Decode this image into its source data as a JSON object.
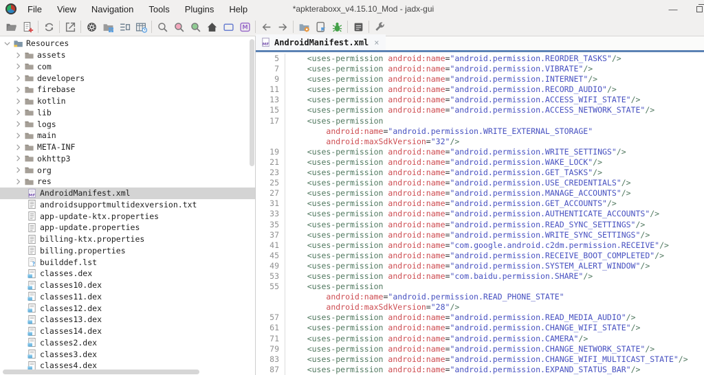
{
  "window": {
    "title": "*apkteraboxx_v4.15.10_Mod - jadx-gui",
    "controls": [
      "minimize",
      "maximize"
    ]
  },
  "colors": {
    "tab_underline": "#5B82B4",
    "selection_bg": "#D4D4D4",
    "tag": "#50785F",
    "attr": "#CD4B50",
    "value": "#4650C0",
    "line_number": "#8F8F8F"
  },
  "menu": [
    "File",
    "View",
    "Navigation",
    "Tools",
    "Plugins",
    "Help"
  ],
  "toolbar": [
    {
      "name": "open-file"
    },
    {
      "name": "add-files"
    },
    {
      "sep": true
    },
    {
      "name": "reload"
    },
    {
      "sep": true
    },
    {
      "name": "export"
    },
    {
      "sep": true
    },
    {
      "name": "deobfuscation"
    },
    {
      "name": "flat-packages"
    },
    {
      "name": "structure"
    },
    {
      "name": "heap-usage"
    },
    {
      "sep": true
    },
    {
      "name": "search"
    },
    {
      "name": "text-search"
    },
    {
      "name": "class-search"
    },
    {
      "name": "main-activity"
    },
    {
      "name": "comment"
    },
    {
      "name": "comment-search"
    },
    {
      "sep": true
    },
    {
      "name": "back"
    },
    {
      "name": "forward"
    },
    {
      "sep": true
    },
    {
      "name": "device-settings"
    },
    {
      "name": "adb-device"
    },
    {
      "name": "debugger"
    },
    {
      "sep": true
    },
    {
      "name": "log-viewer"
    },
    {
      "sep": true
    },
    {
      "name": "preferences"
    }
  ],
  "tree": {
    "items": [
      {
        "label": "Resources",
        "type": "root",
        "chev": "open"
      },
      {
        "label": "assets",
        "type": "folder",
        "chev": "closed"
      },
      {
        "label": "com",
        "type": "folder",
        "chev": "closed"
      },
      {
        "label": "developers",
        "type": "folder",
        "chev": "closed"
      },
      {
        "label": "firebase",
        "type": "folder",
        "chev": "closed"
      },
      {
        "label": "kotlin",
        "type": "folder",
        "chev": "closed"
      },
      {
        "label": "lib",
        "type": "folder",
        "chev": "closed"
      },
      {
        "label": "logs",
        "type": "folder",
        "chev": "closed"
      },
      {
        "label": "main",
        "type": "folder",
        "chev": "closed"
      },
      {
        "label": "META-INF",
        "type": "folder",
        "chev": "closed"
      },
      {
        "label": "okhttp3",
        "type": "folder",
        "chev": "closed"
      },
      {
        "label": "org",
        "type": "folder",
        "chev": "closed"
      },
      {
        "label": "res",
        "type": "folder",
        "chev": "closed"
      },
      {
        "label": "AndroidManifest.xml",
        "type": "manifest",
        "selected": true
      },
      {
        "label": "androidsupportmultidexversion.txt",
        "type": "text"
      },
      {
        "label": "app-update-ktx.properties",
        "type": "text"
      },
      {
        "label": "app-update.properties",
        "type": "text"
      },
      {
        "label": "billing-ktx.properties",
        "type": "text"
      },
      {
        "label": "billing.properties",
        "type": "text"
      },
      {
        "label": "builddef.lst",
        "type": "lst"
      },
      {
        "label": "classes.dex",
        "type": "dex"
      },
      {
        "label": "classes10.dex",
        "type": "dex"
      },
      {
        "label": "classes11.dex",
        "type": "dex"
      },
      {
        "label": "classes12.dex",
        "type": "dex"
      },
      {
        "label": "classes13.dex",
        "type": "dex"
      },
      {
        "label": "classes14.dex",
        "type": "dex"
      },
      {
        "label": "classes2.dex",
        "type": "dex"
      },
      {
        "label": "classes3.dex",
        "type": "dex"
      },
      {
        "label": "classes4.dex",
        "type": "dex"
      }
    ]
  },
  "editor": {
    "tab": "AndroidManifest.xml",
    "tab_close": "×",
    "lines": [
      {
        "num": "5",
        "segs": [
          [
            "s",
            "    "
          ],
          [
            "t",
            "<uses-permission"
          ],
          [
            "s",
            " "
          ],
          [
            "a",
            "android:name"
          ],
          [
            "e",
            "="
          ],
          [
            "v",
            "\"android.permission.REORDER_TASKS\""
          ],
          [
            "t",
            "/>"
          ]
        ]
      },
      {
        "num": "7",
        "segs": [
          [
            "s",
            "    "
          ],
          [
            "t",
            "<uses-permission"
          ],
          [
            "s",
            " "
          ],
          [
            "a",
            "android:name"
          ],
          [
            "e",
            "="
          ],
          [
            "v",
            "\"android.permission.VIBRATE\""
          ],
          [
            "t",
            "/>"
          ]
        ]
      },
      {
        "num": "9",
        "segs": [
          [
            "s",
            "    "
          ],
          [
            "t",
            "<uses-permission"
          ],
          [
            "s",
            " "
          ],
          [
            "a",
            "android:name"
          ],
          [
            "e",
            "="
          ],
          [
            "v",
            "\"android.permission.INTERNET\""
          ],
          [
            "t",
            "/>"
          ]
        ]
      },
      {
        "num": "11",
        "segs": [
          [
            "s",
            "    "
          ],
          [
            "t",
            "<uses-permission"
          ],
          [
            "s",
            " "
          ],
          [
            "a",
            "android:name"
          ],
          [
            "e",
            "="
          ],
          [
            "v",
            "\"android.permission.RECORD_AUDIO\""
          ],
          [
            "t",
            "/>"
          ]
        ]
      },
      {
        "num": "13",
        "segs": [
          [
            "s",
            "    "
          ],
          [
            "t",
            "<uses-permission"
          ],
          [
            "s",
            " "
          ],
          [
            "a",
            "android:name"
          ],
          [
            "e",
            "="
          ],
          [
            "v",
            "\"android.permission.ACCESS_WIFI_STATE\""
          ],
          [
            "t",
            "/>"
          ]
        ]
      },
      {
        "num": "15",
        "segs": [
          [
            "s",
            "    "
          ],
          [
            "t",
            "<uses-permission"
          ],
          [
            "s",
            " "
          ],
          [
            "a",
            "android:name"
          ],
          [
            "e",
            "="
          ],
          [
            "v",
            "\"android.permission.ACCESS_NETWORK_STATE\""
          ],
          [
            "t",
            "/>"
          ]
        ]
      },
      {
        "num": "17",
        "segs": [
          [
            "s",
            "    "
          ],
          [
            "t",
            "<uses-permission"
          ]
        ]
      },
      {
        "num": "",
        "segs": [
          [
            "s",
            "        "
          ],
          [
            "a",
            "android:name"
          ],
          [
            "e",
            "="
          ],
          [
            "v",
            "\"android.permission.WRITE_EXTERNAL_STORAGE\""
          ]
        ]
      },
      {
        "num": "",
        "segs": [
          [
            "s",
            "        "
          ],
          [
            "a",
            "android:maxSdkVersion"
          ],
          [
            "e",
            "="
          ],
          [
            "v",
            "\"32\""
          ],
          [
            "t",
            "/>"
          ]
        ]
      },
      {
        "num": "19",
        "segs": [
          [
            "s",
            "    "
          ],
          [
            "t",
            "<uses-permission"
          ],
          [
            "s",
            " "
          ],
          [
            "a",
            "android:name"
          ],
          [
            "e",
            "="
          ],
          [
            "v",
            "\"android.permission.WRITE_SETTINGS\""
          ],
          [
            "t",
            "/>"
          ]
        ]
      },
      {
        "num": "21",
        "segs": [
          [
            "s",
            "    "
          ],
          [
            "t",
            "<uses-permission"
          ],
          [
            "s",
            " "
          ],
          [
            "a",
            "android:name"
          ],
          [
            "e",
            "="
          ],
          [
            "v",
            "\"android.permission.WAKE_LOCK\""
          ],
          [
            "t",
            "/>"
          ]
        ]
      },
      {
        "num": "23",
        "segs": [
          [
            "s",
            "    "
          ],
          [
            "t",
            "<uses-permission"
          ],
          [
            "s",
            " "
          ],
          [
            "a",
            "android:name"
          ],
          [
            "e",
            "="
          ],
          [
            "v",
            "\"android.permission.GET_TASKS\""
          ],
          [
            "t",
            "/>"
          ]
        ]
      },
      {
        "num": "25",
        "segs": [
          [
            "s",
            "    "
          ],
          [
            "t",
            "<uses-permission"
          ],
          [
            "s",
            " "
          ],
          [
            "a",
            "android:name"
          ],
          [
            "e",
            "="
          ],
          [
            "v",
            "\"android.permission.USE_CREDENTIALS\""
          ],
          [
            "t",
            "/>"
          ]
        ]
      },
      {
        "num": "27",
        "segs": [
          [
            "s",
            "    "
          ],
          [
            "t",
            "<uses-permission"
          ],
          [
            "s",
            " "
          ],
          [
            "a",
            "android:name"
          ],
          [
            "e",
            "="
          ],
          [
            "v",
            "\"android.permission.MANAGE_ACCOUNTS\""
          ],
          [
            "t",
            "/>"
          ]
        ]
      },
      {
        "num": "31",
        "segs": [
          [
            "s",
            "    "
          ],
          [
            "t",
            "<uses-permission"
          ],
          [
            "s",
            " "
          ],
          [
            "a",
            "android:name"
          ],
          [
            "e",
            "="
          ],
          [
            "v",
            "\"android.permission.GET_ACCOUNTS\""
          ],
          [
            "t",
            "/>"
          ]
        ]
      },
      {
        "num": "33",
        "segs": [
          [
            "s",
            "    "
          ],
          [
            "t",
            "<uses-permission"
          ],
          [
            "s",
            " "
          ],
          [
            "a",
            "android:name"
          ],
          [
            "e",
            "="
          ],
          [
            "v",
            "\"android.permission.AUTHENTICATE_ACCOUNTS\""
          ],
          [
            "t",
            "/>"
          ]
        ]
      },
      {
        "num": "35",
        "segs": [
          [
            "s",
            "    "
          ],
          [
            "t",
            "<uses-permission"
          ],
          [
            "s",
            " "
          ],
          [
            "a",
            "android:name"
          ],
          [
            "e",
            "="
          ],
          [
            "v",
            "\"android.permission.READ_SYNC_SETTINGS\""
          ],
          [
            "t",
            "/>"
          ]
        ]
      },
      {
        "num": "37",
        "segs": [
          [
            "s",
            "    "
          ],
          [
            "t",
            "<uses-permission"
          ],
          [
            "s",
            " "
          ],
          [
            "a",
            "android:name"
          ],
          [
            "e",
            "="
          ],
          [
            "v",
            "\"android.permission.WRITE_SYNC_SETTINGS\""
          ],
          [
            "t",
            "/>"
          ]
        ]
      },
      {
        "num": "41",
        "segs": [
          [
            "s",
            "    "
          ],
          [
            "t",
            "<uses-permission"
          ],
          [
            "s",
            " "
          ],
          [
            "a",
            "android:name"
          ],
          [
            "e",
            "="
          ],
          [
            "v",
            "\"com.google.android.c2dm.permission.RECEIVE\""
          ],
          [
            "t",
            "/>"
          ]
        ]
      },
      {
        "num": "45",
        "segs": [
          [
            "s",
            "    "
          ],
          [
            "t",
            "<uses-permission"
          ],
          [
            "s",
            " "
          ],
          [
            "a",
            "android:name"
          ],
          [
            "e",
            "="
          ],
          [
            "v",
            "\"android.permission.RECEIVE_BOOT_COMPLETED\""
          ],
          [
            "t",
            "/>"
          ]
        ]
      },
      {
        "num": "49",
        "segs": [
          [
            "s",
            "    "
          ],
          [
            "t",
            "<uses-permission"
          ],
          [
            "s",
            " "
          ],
          [
            "a",
            "android:name"
          ],
          [
            "e",
            "="
          ],
          [
            "v",
            "\"android.permission.SYSTEM_ALERT_WINDOW\""
          ],
          [
            "t",
            "/>"
          ]
        ]
      },
      {
        "num": "53",
        "segs": [
          [
            "s",
            "    "
          ],
          [
            "t",
            "<uses-permission"
          ],
          [
            "s",
            " "
          ],
          [
            "a",
            "android:name"
          ],
          [
            "e",
            "="
          ],
          [
            "v",
            "\"com.baidu.permission.SHARE\""
          ],
          [
            "t",
            "/>"
          ]
        ]
      },
      {
        "num": "55",
        "segs": [
          [
            "s",
            "    "
          ],
          [
            "t",
            "<uses-permission"
          ]
        ]
      },
      {
        "num": "",
        "segs": [
          [
            "s",
            "        "
          ],
          [
            "a",
            "android:name"
          ],
          [
            "e",
            "="
          ],
          [
            "v",
            "\"android.permission.READ_PHONE_STATE\""
          ]
        ]
      },
      {
        "num": "",
        "segs": [
          [
            "s",
            "        "
          ],
          [
            "a",
            "android:maxSdkVersion"
          ],
          [
            "e",
            "="
          ],
          [
            "v",
            "\"28\""
          ],
          [
            "t",
            "/>"
          ]
        ]
      },
      {
        "num": "57",
        "segs": [
          [
            "s",
            "    "
          ],
          [
            "t",
            "<uses-permission"
          ],
          [
            "s",
            " "
          ],
          [
            "a",
            "android:name"
          ],
          [
            "e",
            "="
          ],
          [
            "v",
            "\"android.permission.READ_MEDIA_AUDIO\""
          ],
          [
            "t",
            "/>"
          ]
        ]
      },
      {
        "num": "61",
        "segs": [
          [
            "s",
            "    "
          ],
          [
            "t",
            "<uses-permission"
          ],
          [
            "s",
            " "
          ],
          [
            "a",
            "android:name"
          ],
          [
            "e",
            "="
          ],
          [
            "v",
            "\"android.permission.CHANGE_WIFI_STATE\""
          ],
          [
            "t",
            "/>"
          ]
        ]
      },
      {
        "num": "71",
        "segs": [
          [
            "s",
            "    "
          ],
          [
            "t",
            "<uses-permission"
          ],
          [
            "s",
            " "
          ],
          [
            "a",
            "android:name"
          ],
          [
            "e",
            "="
          ],
          [
            "v",
            "\"android.permission.CAMERA\""
          ],
          [
            "t",
            "/>"
          ]
        ]
      },
      {
        "num": "79",
        "segs": [
          [
            "s",
            "    "
          ],
          [
            "t",
            "<uses-permission"
          ],
          [
            "s",
            " "
          ],
          [
            "a",
            "android:name"
          ],
          [
            "e",
            "="
          ],
          [
            "v",
            "\"android.permission.CHANGE_NETWORK_STATE\""
          ],
          [
            "t",
            "/>"
          ]
        ]
      },
      {
        "num": "83",
        "segs": [
          [
            "s",
            "    "
          ],
          [
            "t",
            "<uses-permission"
          ],
          [
            "s",
            " "
          ],
          [
            "a",
            "android:name"
          ],
          [
            "e",
            "="
          ],
          [
            "v",
            "\"android.permission.CHANGE_WIFI_MULTICAST_STATE\""
          ],
          [
            "t",
            "/>"
          ]
        ]
      },
      {
        "num": "87",
        "segs": [
          [
            "s",
            "    "
          ],
          [
            "t",
            "<uses-permission"
          ],
          [
            "s",
            " "
          ],
          [
            "a",
            "android:name"
          ],
          [
            "e",
            "="
          ],
          [
            "v",
            "\"android.permission.EXPAND_STATUS_BAR\""
          ],
          [
            "t",
            "/>"
          ]
        ]
      }
    ]
  }
}
